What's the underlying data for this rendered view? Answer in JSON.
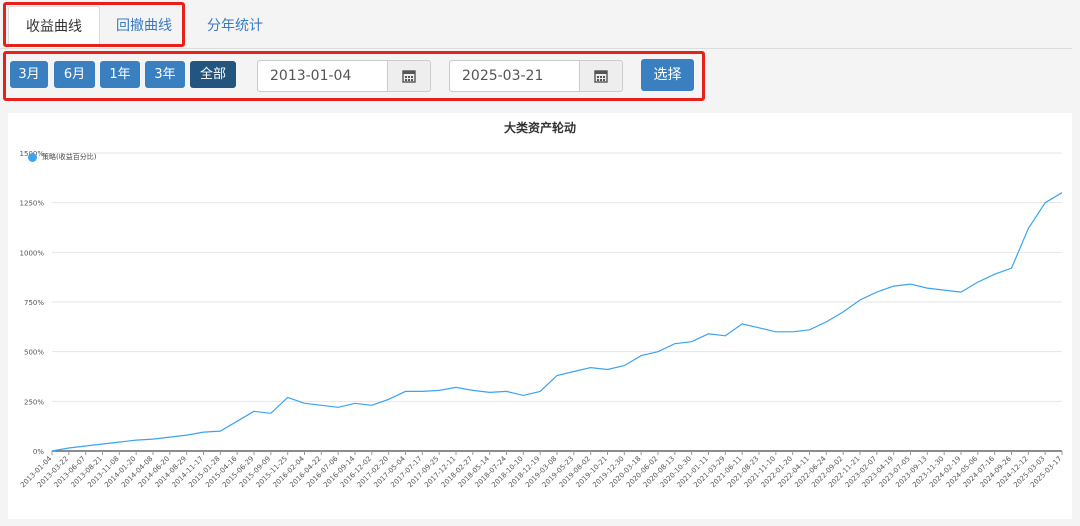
{
  "tabs": [
    {
      "label": "收益曲线",
      "active": true
    },
    {
      "label": "回撤曲线",
      "active": false
    },
    {
      "label": "分年统计",
      "active": false
    }
  ],
  "range_buttons": [
    {
      "label": "3月",
      "active": false
    },
    {
      "label": "6月",
      "active": false
    },
    {
      "label": "1年",
      "active": false
    },
    {
      "label": "3年",
      "active": false
    },
    {
      "label": "全部",
      "active": true
    }
  ],
  "date_start": "2013-01-04",
  "date_end": "2025-03-21",
  "select_label": "选择",
  "icons": {
    "calendar": "calendar-icon"
  },
  "colors": {
    "accent": "#3a80c0",
    "series": "#3ca3f0",
    "highlight": "#e8201c"
  },
  "chart_data": {
    "type": "line",
    "title": "大类资产轮动",
    "xlabel": "",
    "ylabel": "",
    "ylim": [
      0,
      1500
    ],
    "yticks": [
      0,
      250,
      500,
      750,
      1000,
      1250,
      1500
    ],
    "ytick_labels": [
      "0%",
      "250%",
      "500%",
      "750%",
      "1000%",
      "1250%",
      "1500%"
    ],
    "grid": true,
    "legend": "top-left",
    "xtick_labels": [
      "2013-01-04",
      "2013-03-22",
      "2013-06-07",
      "2013-08-21",
      "2013-11-08",
      "2014-01-20",
      "2014-04-08",
      "2014-06-20",
      "2014-08-29",
      "2014-11-17",
      "2015-01-28",
      "2015-04-16",
      "2015-06-29",
      "2015-09-09",
      "2015-11-25",
      "2016-02-04",
      "2016-04-22",
      "2016-07-06",
      "2016-09-14",
      "2016-12-02",
      "2017-02-20",
      "2017-05-04",
      "2017-07-17",
      "2017-09-25",
      "2017-12-11",
      "2018-02-27",
      "2018-05-14",
      "2018-07-24",
      "2018-10-10",
      "2018-12-19",
      "2019-03-08",
      "2019-05-23",
      "2019-08-02",
      "2019-10-21",
      "2019-12-30",
      "2020-03-18",
      "2020-06-02",
      "2020-08-13",
      "2020-10-30",
      "2021-01-11",
      "2021-03-29",
      "2021-06-11",
      "2021-08-23",
      "2021-11-10",
      "2022-01-20",
      "2022-04-11",
      "2022-06-24",
      "2022-09-02",
      "2022-11-21",
      "2023-02-07",
      "2023-04-19",
      "2023-07-05",
      "2023-09-13",
      "2023-11-30",
      "2024-02-19",
      "2024-05-06",
      "2024-07-16",
      "2024-09-26",
      "2024-12-12",
      "2025-03-03",
      "2025-03-17"
    ],
    "series": [
      {
        "name": "策略(收益百分比)",
        "x": [
          0,
          1,
          2,
          3,
          4,
          5,
          6,
          7,
          8,
          9,
          10,
          11,
          12,
          13,
          14,
          15,
          16,
          17,
          18,
          19,
          20,
          21,
          22,
          23,
          24,
          25,
          26,
          27,
          28,
          29,
          30,
          31,
          32,
          33,
          34,
          35,
          36,
          37,
          38,
          39,
          40,
          41,
          42,
          43,
          44,
          45,
          46,
          47,
          48,
          49,
          50,
          51,
          52,
          53,
          54,
          55,
          56,
          57,
          58,
          59,
          60
        ],
        "values": [
          0,
          15,
          25,
          35,
          45,
          55,
          60,
          70,
          80,
          95,
          100,
          150,
          200,
          190,
          270,
          240,
          230,
          220,
          240,
          230,
          260,
          300,
          300,
          305,
          320,
          305,
          295,
          300,
          280,
          300,
          380,
          400,
          420,
          410,
          430,
          480,
          500,
          540,
          550,
          590,
          580,
          640,
          620,
          600,
          600,
          610,
          650,
          700,
          760,
          800,
          830,
          840,
          820,
          810,
          800,
          850,
          890,
          920,
          1120,
          1250,
          1300
        ]
      }
    ]
  }
}
